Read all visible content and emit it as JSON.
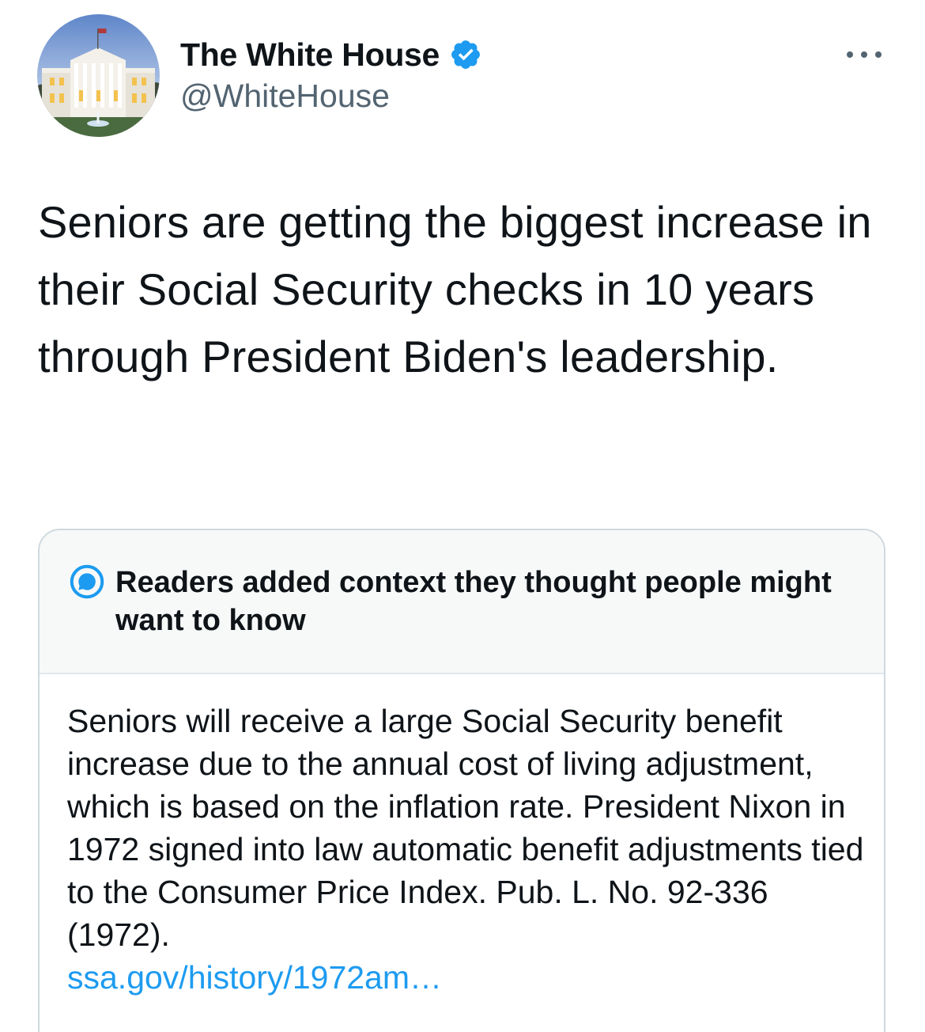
{
  "author": {
    "display_name": "The White House",
    "handle": "@WhiteHouse",
    "verified": true,
    "avatar_icon": "white-house-avatar"
  },
  "more_icon": "more-options-icon",
  "tweet": {
    "text": "Seniors are getting the biggest increase in their Social Security checks in 10 years through President Biden's leadership."
  },
  "community_note": {
    "icon": "community-notes-icon",
    "title": "Readers added context they thought people might want to know",
    "body": "Seniors will receive a large Social Security benefit increase due to the annual cost of living adjustment, which is based on the inflation rate. President Nixon in 1972 signed into law automatic benefit adjustments tied to the Consumer Price Index. Pub. L. No. 92-336 (1972).",
    "link_text": "ssa.gov/history/1972am…"
  },
  "colors": {
    "text": "#0f1419",
    "secondary": "#536471",
    "link": "#1d9bf0",
    "verified": "#1d9bf0",
    "note_header_bg": "#f7f9f9",
    "border": "#cfd9de"
  }
}
